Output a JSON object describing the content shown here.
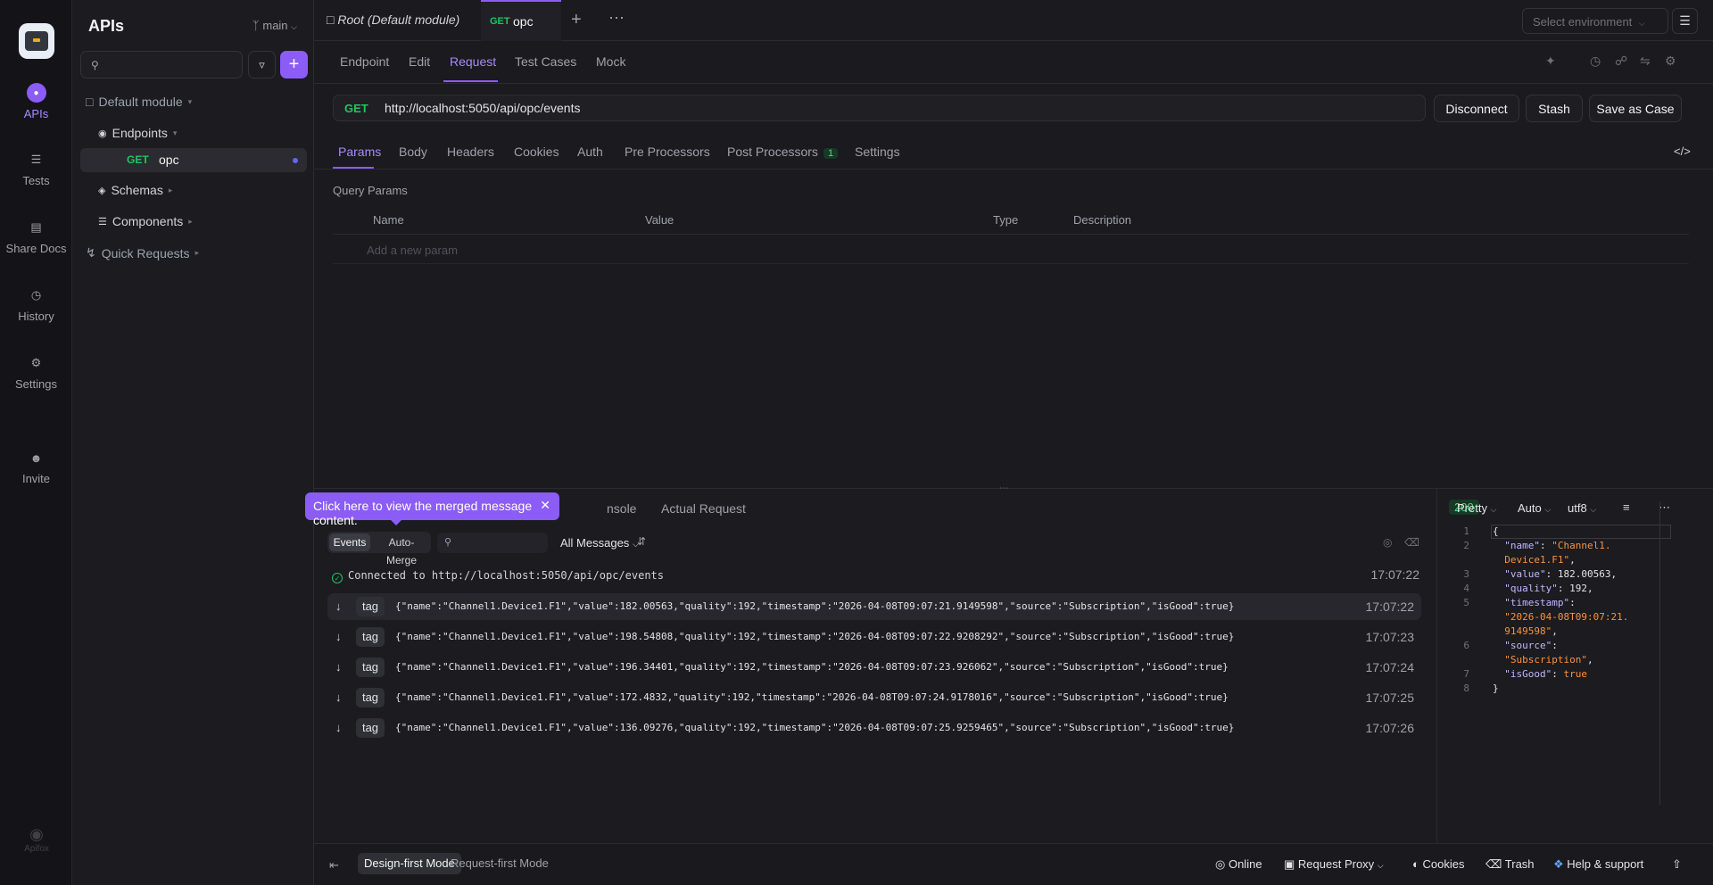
{
  "rail": {
    "items": [
      {
        "label": "APIs",
        "icon": "apis-icon"
      },
      {
        "label": "Tests",
        "icon": "tests-icon"
      },
      {
        "label": "Share Docs",
        "icon": "book-icon"
      },
      {
        "label": "History",
        "icon": "history-icon"
      },
      {
        "label": "Settings",
        "icon": "settings-icon"
      },
      {
        "label": "Invite",
        "icon": "invite-icon"
      }
    ],
    "brand": "Apifox"
  },
  "sidebar": {
    "title": "APIs",
    "branch": "main",
    "tree": {
      "module": "Default module",
      "endpoints": "Endpoints",
      "selected_method": "GET",
      "selected_name": "opc",
      "schemas": "Schemas",
      "components": "Components",
      "quick_requests": "Quick Requests"
    }
  },
  "tabbar": {
    "doc_tab": "Root (Default module)",
    "active_method": "GET",
    "active_name": "opc",
    "env_placeholder": "Select environment"
  },
  "subtabs": [
    "Endpoint",
    "Edit",
    "Request",
    "Test Cases",
    "Mock"
  ],
  "request": {
    "method": "GET",
    "url": "http://localhost:5050/api/opc/events",
    "buttons": {
      "disconnect": "Disconnect",
      "stash": "Stash",
      "save_case": "Save as Case"
    },
    "tabs": [
      "Params",
      "Body",
      "Headers",
      "Cookies",
      "Auth",
      "Pre Processors",
      "Post Processors",
      "Settings"
    ],
    "post_processors_count": "1",
    "query_params_title": "Query Params",
    "columns": [
      "Name",
      "Value",
      "Type",
      "Description"
    ],
    "add_param": "Add a new param"
  },
  "response": {
    "tabs": [
      "nsole",
      "Actual Request"
    ],
    "status": "200",
    "tooltip": "Click here to view the merged message content.",
    "seg_events": "Events",
    "seg_merge": "Auto-Merge",
    "all_messages": "All Messages",
    "connected": "Connected to http://localhost:5050/api/opc/events",
    "connected_time": "17:07:22",
    "events": [
      {
        "tag": "tag",
        "json": "{\"name\":\"Channel1.Device1.F1\",\"value\":182.00563,\"quality\":192,\"timestamp\":\"2026-04-08T09:07:21.9149598\",\"source\":\"Subscription\",\"isGood\":true}",
        "time": "17:07:22"
      },
      {
        "tag": "tag",
        "json": "{\"name\":\"Channel1.Device1.F1\",\"value\":198.54808,\"quality\":192,\"timestamp\":\"2026-04-08T09:07:22.9208292\",\"source\":\"Subscription\",\"isGood\":true}",
        "time": "17:07:23"
      },
      {
        "tag": "tag",
        "json": "{\"name\":\"Channel1.Device1.F1\",\"value\":196.34401,\"quality\":192,\"timestamp\":\"2026-04-08T09:07:23.926062\",\"source\":\"Subscription\",\"isGood\":true}",
        "time": "17:07:24"
      },
      {
        "tag": "tag",
        "json": "{\"name\":\"Channel1.Device1.F1\",\"value\":172.4832,\"quality\":192,\"timestamp\":\"2026-04-08T09:07:24.9178016\",\"source\":\"Subscription\",\"isGood\":true}",
        "time": "17:07:25"
      },
      {
        "tag": "tag",
        "json": "{\"name\":\"Channel1.Device1.F1\",\"value\":136.09276,\"quality\":192,\"timestamp\":\"2026-04-08T09:07:25.9259465\",\"source\":\"Subscription\",\"isGood\":true}",
        "time": "17:07:26"
      }
    ],
    "viewer": {
      "format": "Pretty",
      "mode": "Auto",
      "encoding": "utf8"
    }
  },
  "footer": {
    "design_mode": "Design-first Mode",
    "request_mode": "Request-first Mode",
    "online": "Online",
    "proxy": "Request Proxy",
    "cookies": "Cookies",
    "trash": "Trash",
    "help": "Help & support"
  },
  "colors": {
    "accent": "#8b5cf6",
    "get": "#22c55e",
    "bg": "#1a1a1f"
  }
}
